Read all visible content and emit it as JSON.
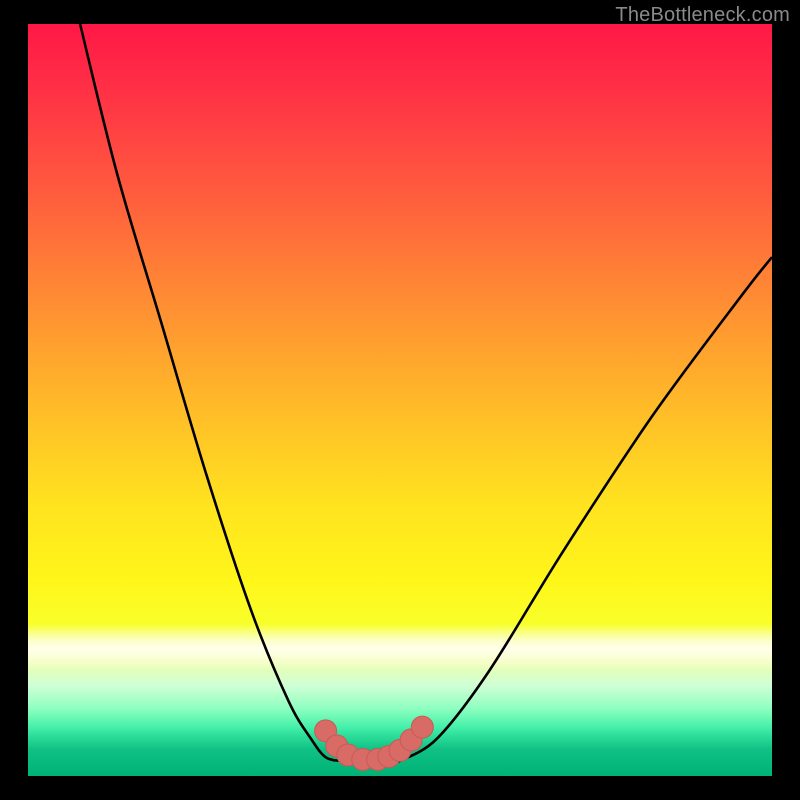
{
  "watermark": "TheBottleneck.com",
  "colors": {
    "background": "#000000",
    "curve_stroke": "#000000",
    "marker_fill": "#d86b66",
    "marker_stroke": "#c95a55"
  },
  "chart_data": {
    "type": "line",
    "title": "",
    "xlabel": "",
    "ylabel": "",
    "xlim": [
      0,
      100
    ],
    "ylim": [
      0,
      100
    ],
    "grid": false,
    "legend": false,
    "series": [
      {
        "name": "left-branch",
        "x": [
          7,
          12,
          18,
          24,
          30,
          35,
          38,
          40,
          42
        ],
        "values": [
          100,
          80,
          60,
          40,
          22,
          10,
          5,
          2.5,
          2
        ]
      },
      {
        "name": "right-branch",
        "x": [
          50,
          55,
          62,
          72,
          84,
          96,
          100
        ],
        "values": [
          2,
          5,
          14,
          30,
          48,
          64,
          69
        ]
      },
      {
        "name": "floor",
        "x": [
          42,
          44,
          46,
          48,
          50
        ],
        "values": [
          2,
          1.6,
          1.5,
          1.6,
          2
        ]
      }
    ],
    "markers": {
      "name": "bottom-markers",
      "x": [
        40,
        41.5,
        43,
        45,
        47,
        48.5,
        50,
        51.5,
        53
      ],
      "values": [
        6,
        4,
        2.8,
        2.2,
        2.2,
        2.6,
        3.4,
        4.8,
        6.5
      ]
    }
  }
}
